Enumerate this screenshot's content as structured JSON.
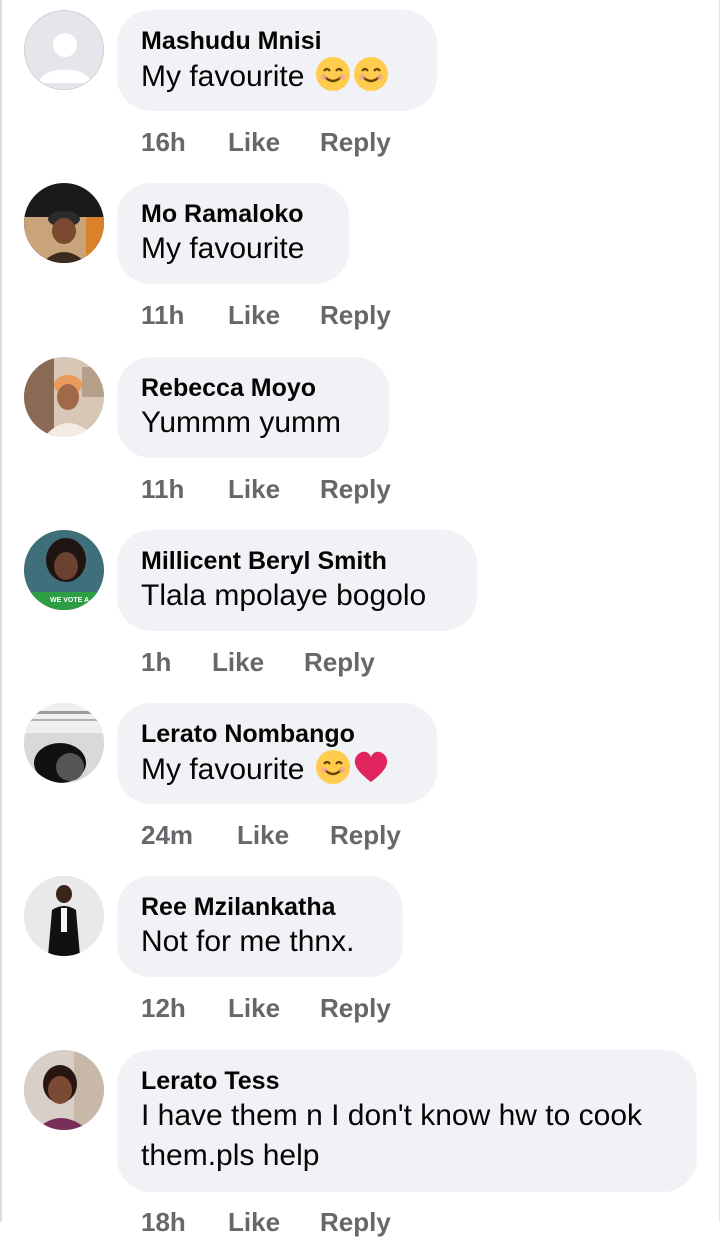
{
  "comments": [
    {
      "author": "Mashudu Mnisi",
      "text": "My favourite",
      "emojis": [
        "smiling-face-icon",
        "smiling-face-icon"
      ],
      "time": "16h",
      "like": "Like",
      "reply": "Reply"
    },
    {
      "author": "Mo Ramaloko",
      "text": "My favourite",
      "emojis": [],
      "time": "11h",
      "like": "Like",
      "reply": "Reply"
    },
    {
      "author": "Rebecca Moyo",
      "text": "Yummm yumm",
      "emojis": [],
      "time": "11h",
      "like": "Like",
      "reply": "Reply"
    },
    {
      "author": "Millicent Beryl Smith",
      "text": "Tlala mpolaye bogolo",
      "emojis": [],
      "time": "1h",
      "like": "Like",
      "reply": "Reply",
      "avatar_banner": "WE VOTE A"
    },
    {
      "author": "Lerato Nombango",
      "text": "My favourite",
      "emojis": [
        "smiling-face-icon",
        "red-heart-icon"
      ],
      "time": "24m",
      "like": "Like",
      "reply": "Reply"
    },
    {
      "author": "Ree Mzilankatha",
      "text": "Not for me thnx.",
      "emojis": [],
      "time": "12h",
      "like": "Like",
      "reply": "Reply"
    },
    {
      "author": "Lerato Tess",
      "text": "I have them n I don't know hw to cook them.pls help",
      "emojis": [],
      "time": "18h",
      "like": "Like",
      "reply": "Reply"
    }
  ],
  "colors": {
    "bubble": "#f0f2f5",
    "secondary_text": "#65676b",
    "primary_text": "#050505",
    "heart": "#e0245e",
    "emoji_face": "#ffcc4d"
  }
}
